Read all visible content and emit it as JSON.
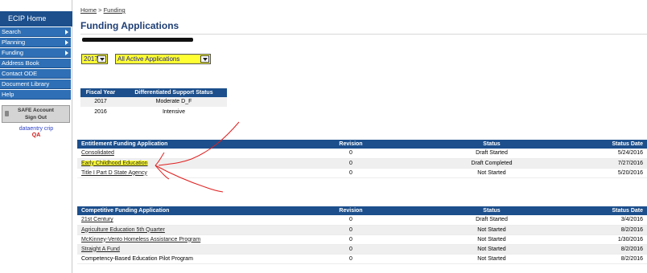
{
  "sidebar": {
    "home": "ECIP Home",
    "items": [
      {
        "label": "Search",
        "has_arrow": true
      },
      {
        "label": "Planning",
        "has_arrow": true
      },
      {
        "label": "Funding",
        "has_arrow": true
      },
      {
        "label": "Address Book",
        "has_arrow": false
      },
      {
        "label": "Contact ODE",
        "has_arrow": false
      },
      {
        "label": "Document Library",
        "has_arrow": false
      },
      {
        "label": "Help",
        "has_arrow": false
      }
    ],
    "safe_button_line1": "SAFE Account",
    "safe_button_line2": "Sign Out",
    "user_name": "dataentry crip",
    "user_role": "QA"
  },
  "breadcrumb": {
    "home": "Home",
    "separator": " > ",
    "current": "Funding"
  },
  "page_title": "Funding Applications",
  "filters": {
    "year": "2017",
    "status": "All Active Applications"
  },
  "fiscal_table": {
    "headers": [
      "Fiscal Year",
      "Differentiated Support Status"
    ],
    "rows": [
      [
        "2017",
        "Moderate D_F"
      ],
      [
        "2016",
        "Intensive"
      ]
    ]
  },
  "entitlement_table": {
    "headers": [
      "Entitlement Funding Application",
      "Revision",
      "Status",
      "Status Date"
    ],
    "rows": [
      [
        "Consolidated",
        "0",
        "Draft Started",
        "5/24/2016"
      ],
      [
        "Early Childhood Education",
        "0",
        "Draft Completed",
        "7/27/2016"
      ],
      [
        "Title I Part D State Agency",
        "0",
        "Not Started",
        "5/20/2016"
      ]
    ]
  },
  "competitive_table": {
    "headers": [
      "Competitive Funding Application",
      "Revision",
      "Status",
      "Status Date"
    ],
    "rows": [
      [
        "21st Century",
        "0",
        "Draft Started",
        "3/4/2016"
      ],
      [
        "Agriculture Education 5th Quarter",
        "0",
        "Not Started",
        "8/2/2016"
      ],
      [
        "McKinney-Vento Homeless Assistance Program",
        "0",
        "Not Started",
        "1/30/2016"
      ],
      [
        "Straight A Fund",
        "0",
        "Not Started",
        "8/2/2016"
      ],
      [
        "Competency-Based Education Pilot Program",
        "0",
        "Not Started",
        "8/2/2016"
      ]
    ]
  },
  "colors": {
    "nav_dark": "#1c4f8c",
    "nav_item": "#2e6fb5",
    "highlight": "#ffff33",
    "annotation": "#e02020"
  }
}
